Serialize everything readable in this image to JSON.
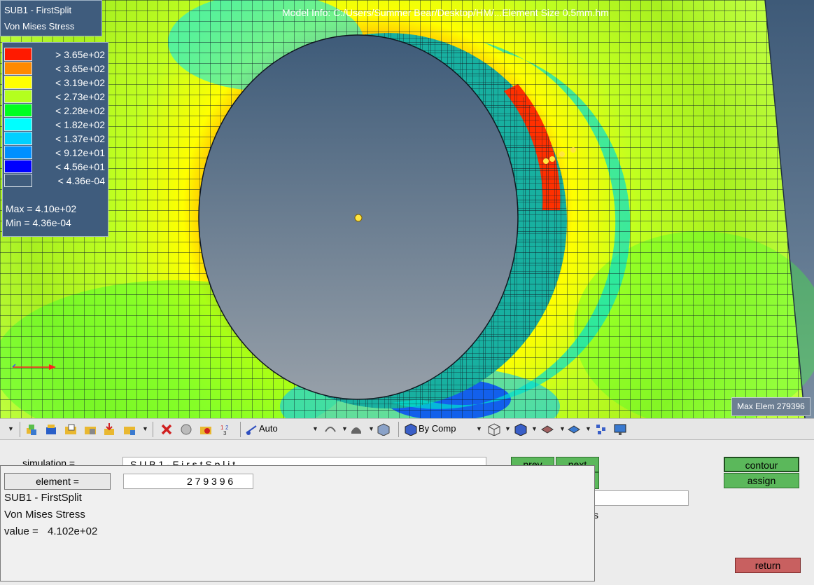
{
  "viewport": {
    "model_info": "Model Info: C:/Users/Summer Bear/Desktop/HM/...Element Size 0.5mm.hm",
    "header_line1": "SUB1 - FirstSplit",
    "header_line2": "Von Mises Stress",
    "legend": {
      "entries": [
        {
          "label": "> 3.65e+02",
          "color": "#ff1a00"
        },
        {
          "label": "< 3.65e+02",
          "color": "#ff8a00"
        },
        {
          "label": "< 3.19e+02",
          "color": "#ffff00"
        },
        {
          "label": "< 2.73e+02",
          "color": "#b4ff1e"
        },
        {
          "label": "< 2.28e+02",
          "color": "#00ff20"
        },
        {
          "label": "< 1.82e+02",
          "color": "#00ffff"
        },
        {
          "label": "< 1.37e+02",
          "color": "#00d0ff"
        },
        {
          "label": "< 9.12e+01",
          "color": "#0090ff"
        },
        {
          "label": "< 4.56e+01",
          "color": "#0000ff"
        },
        {
          "label": "< 4.36e-04",
          "color": "#3f5c7d"
        }
      ],
      "max_label": "Max = 4.10e+02",
      "min_label": "Min = 4.36e-04"
    },
    "max_elem_label": "Max Elem 279396"
  },
  "toolbar": {
    "display_mode": "Auto",
    "color_mode": "By Comp"
  },
  "panel": {
    "simulation_label": "simulation =",
    "simulation_value": "S U B 1   -   F i r s t S p l i t",
    "prev_label": "prev",
    "next_label": "next",
    "partial_s": "s",
    "contour_label": "contour",
    "assign_label": "assign",
    "return_label": "return"
  },
  "popup": {
    "element_label": "element =",
    "element_value": "2 7 9 3 9 6",
    "line1": "SUB1 - FirstSplit",
    "line2": "Von Mises Stress",
    "value_label": "value =",
    "value": "4.102e+02"
  }
}
